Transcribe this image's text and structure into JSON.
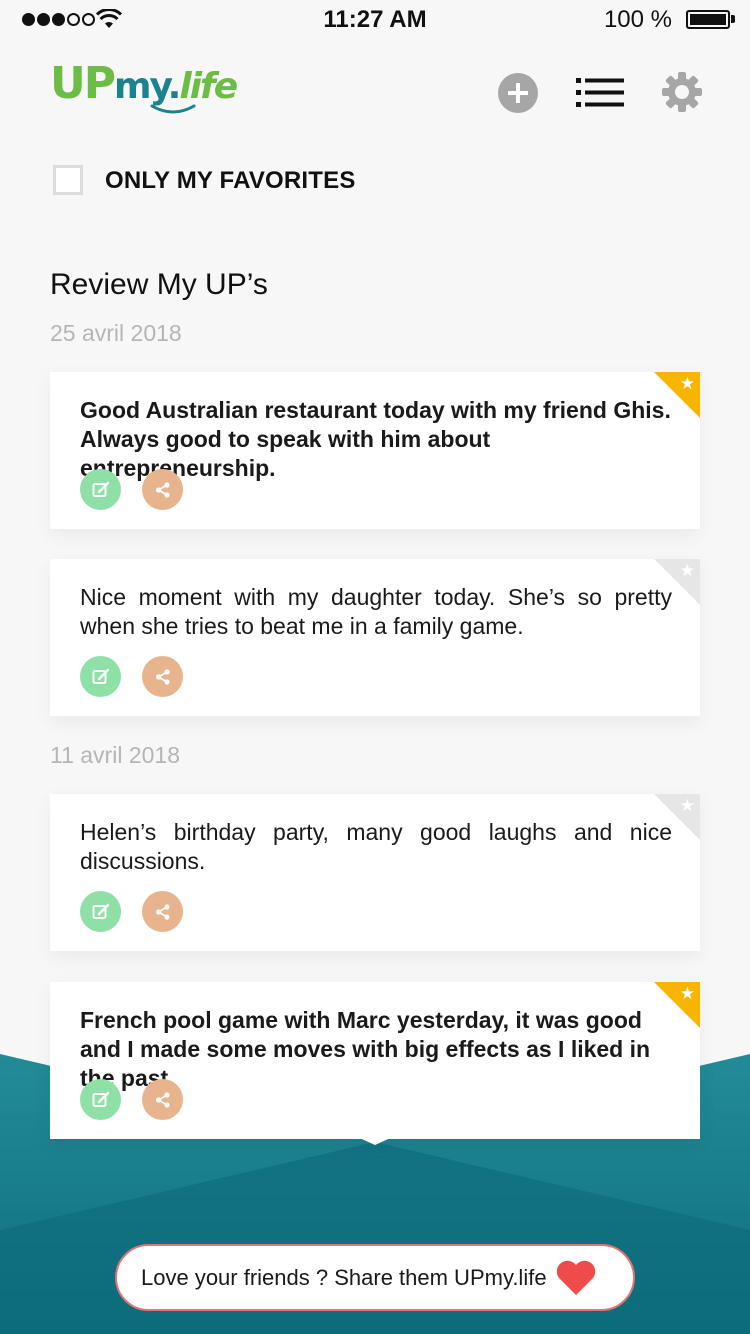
{
  "status_bar": {
    "time": "11:27 AM",
    "battery_percent": "100 %",
    "signal_bars_filled": 3,
    "signal_bars_total": 5
  },
  "header": {
    "logo_parts": [
      "UP",
      "my",
      "life"
    ],
    "logo_dot": ".",
    "add_icon": "plus-circle-icon",
    "list_icon": "list-icon",
    "settings_icon": "gear-icon"
  },
  "filter": {
    "favorites_label": "ONLY MY FAVORITES",
    "checked": false
  },
  "section_title": "Review My UP’s",
  "groups": [
    {
      "date": "25 avril 2018",
      "entries": [
        {
          "text": "Good Australian restaurant today with my friend Ghis. Always good to speak with him about entrepreneurship.",
          "favorite": true
        },
        {
          "text": "Nice moment with my daughter today. She’s so pretty when she tries to beat me in a family game.",
          "favorite": false
        }
      ]
    },
    {
      "date": "11 avril 2018",
      "entries": [
        {
          "text": "Helen’s birthday party, many good laughs and nice discussions.",
          "favorite": false
        },
        {
          "text": "French pool game with Marc yesterday, it was good and I made some moves with big effects as I liked in the past.",
          "favorite": true
        }
      ]
    }
  ],
  "share_banner": {
    "text": "Love your friends ? Share them UPmy.life",
    "icon": "heart-icon"
  },
  "colors": {
    "favorite_star": "#f7b500",
    "edit_button": "#8ee0a7",
    "share_button": "#e8b48d",
    "teal": "#1b8290",
    "logo_green": "#6cbd45",
    "heart": "#ef4b4b"
  }
}
